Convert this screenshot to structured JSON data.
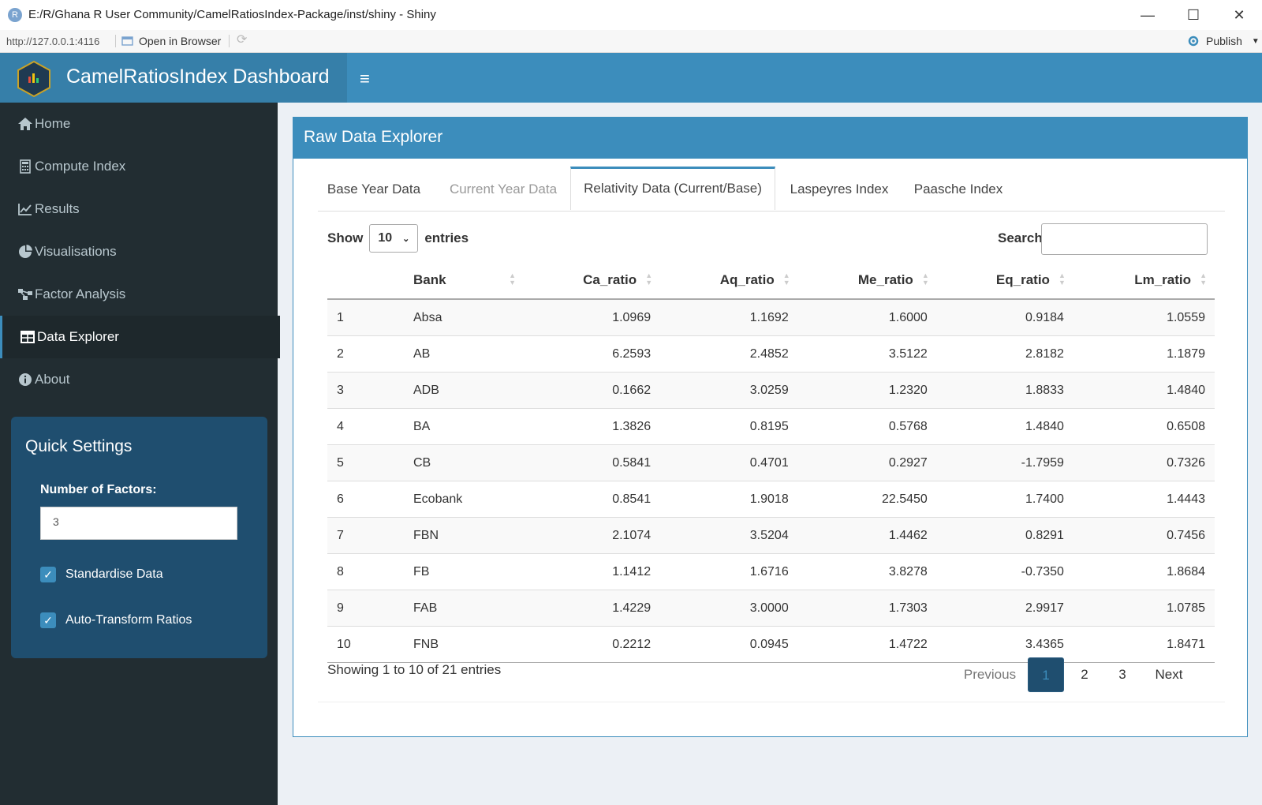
{
  "window": {
    "title": "E:/R/Ghana R User Community/CamelRatiosIndex-Package/inst/shiny - Shiny",
    "app_icon": "R",
    "minimize_icon": "—",
    "maximize_icon": "☐",
    "close_icon": "✕"
  },
  "addressbar": {
    "url": "http://127.0.0.1:4116",
    "open_browser": "Open in Browser",
    "publish": "Publish"
  },
  "header": {
    "title": "CamelRatiosIndex Dashboard",
    "menu_icon": "≡"
  },
  "sidebar": {
    "items": [
      {
        "label": "Home",
        "icon": "home-icon"
      },
      {
        "label": "Compute Index",
        "icon": "calculator-icon"
      },
      {
        "label": "Results",
        "icon": "line-chart-icon"
      },
      {
        "label": "Visualisations",
        "icon": "pie-chart-icon"
      },
      {
        "label": "Factor Analysis",
        "icon": "sitemap-icon"
      },
      {
        "label": "Data Explorer",
        "icon": "table-icon",
        "active": true
      },
      {
        "label": "About",
        "icon": "info-icon"
      }
    ],
    "quick_settings": {
      "title": "Quick Settings",
      "factors_label": "Number of Factors:",
      "factors_value": "3",
      "standardise_label": "Standardise Data",
      "standardise_checked": true,
      "autotransform_label": "Auto-Transform Ratios",
      "autotransform_checked": true
    }
  },
  "main": {
    "box_title": "Raw Data Explorer",
    "tabs": [
      {
        "label": "Base Year Data"
      },
      {
        "label": "Current Year Data"
      },
      {
        "label": "Relativity Data (Current/Base)",
        "active": true
      },
      {
        "label": "Laspeyres Index"
      },
      {
        "label": "Paasche Index"
      }
    ],
    "show_label": "Show",
    "entries_value": "10",
    "entries_label": "entries",
    "search_label": "Search:",
    "search_value": "",
    "columns": [
      "",
      "Bank",
      "Ca_ratio",
      "Aq_ratio",
      "Me_ratio",
      "Eq_ratio",
      "Lm_ratio"
    ],
    "rows": [
      [
        "1",
        "Absa",
        "1.0969",
        "1.1692",
        "1.6000",
        "0.9184",
        "1.0559"
      ],
      [
        "2",
        "AB",
        "6.2593",
        "2.4852",
        "3.5122",
        "2.8182",
        "1.1879"
      ],
      [
        "3",
        "ADB",
        "0.1662",
        "3.0259",
        "1.2320",
        "1.8833",
        "1.4840"
      ],
      [
        "4",
        "BA",
        "1.3826",
        "0.8195",
        "0.5768",
        "1.4840",
        "0.6508"
      ],
      [
        "5",
        "CB",
        "0.5841",
        "0.4701",
        "0.2927",
        "-1.7959",
        "0.7326"
      ],
      [
        "6",
        "Ecobank",
        "0.8541",
        "1.9018",
        "22.5450",
        "1.7400",
        "1.4443"
      ],
      [
        "7",
        "FBN",
        "2.1074",
        "3.5204",
        "1.4462",
        "0.8291",
        "0.7456"
      ],
      [
        "8",
        "FB",
        "1.1412",
        "1.6716",
        "3.8278",
        "-0.7350",
        "1.8684"
      ],
      [
        "9",
        "FAB",
        "1.4229",
        "3.0000",
        "1.7303",
        "2.9917",
        "1.0785"
      ],
      [
        "10",
        "FNB",
        "0.2212",
        "0.0945",
        "1.4722",
        "3.4365",
        "1.8471"
      ]
    ],
    "info": "Showing 1 to 10 of 21 entries",
    "pagination": {
      "previous": "Previous",
      "pages": [
        "1",
        "2",
        "3"
      ],
      "current": "1",
      "next": "Next"
    }
  },
  "colors": {
    "header": "#3c8dbc",
    "header_logo": "#367fa9",
    "sidebar": "#222d32",
    "quick_settings": "#1f4e6f"
  }
}
